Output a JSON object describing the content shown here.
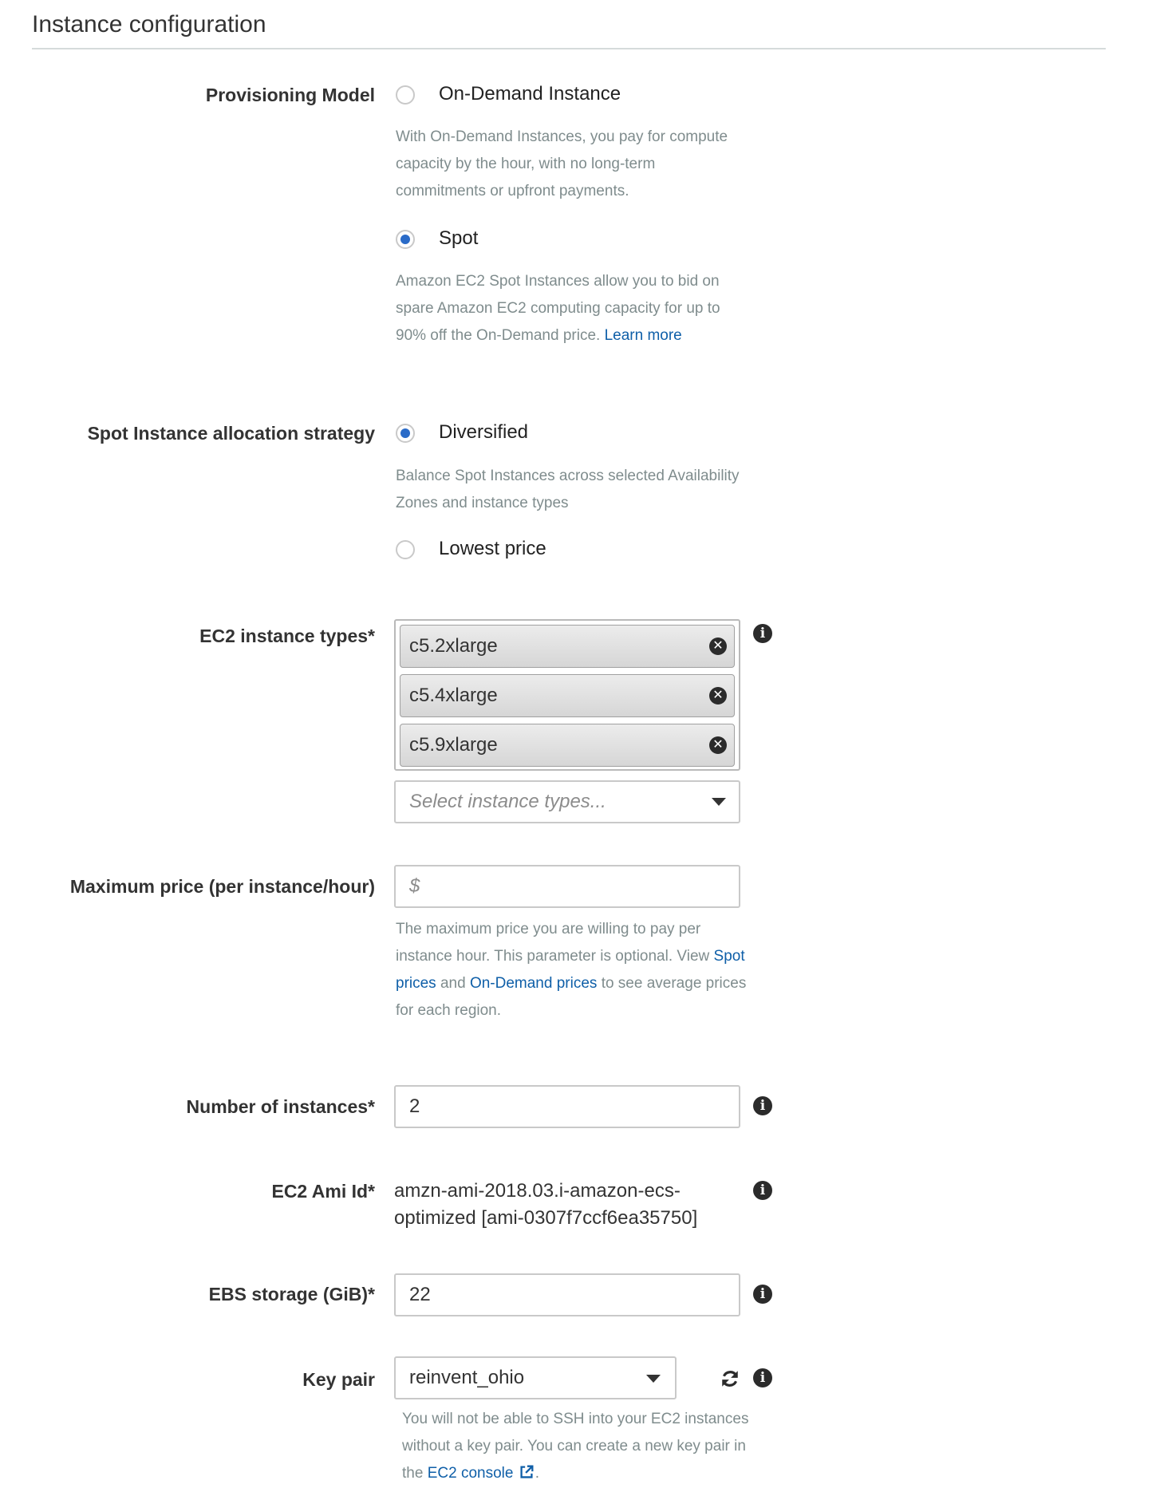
{
  "section": {
    "title": "Instance configuration"
  },
  "provisioning_model": {
    "label": "Provisioning Model",
    "options": [
      {
        "label": "On-Demand Instance",
        "checked": false,
        "help": "With On-Demand Instances, you pay for compute capacity by the hour, with no long-term commitments or upfront payments."
      },
      {
        "label": "Spot",
        "checked": true,
        "help": "Amazon EC2 Spot Instances allow you to bid on spare Amazon EC2 computing capacity for up to 90% off the On-Demand price.",
        "link": "Learn more"
      }
    ]
  },
  "allocation_strategy": {
    "label": "Spot Instance allocation strategy",
    "options": [
      {
        "label": "Diversified",
        "checked": true,
        "help": "Balance Spot Instances across selected Availability Zones and instance types"
      },
      {
        "label": "Lowest price",
        "checked": false
      }
    ]
  },
  "instance_types": {
    "label": "EC2 instance types*",
    "selected": [
      "c5.2xlarge",
      "c5.4xlarge",
      "c5.9xlarge"
    ],
    "placeholder": "Select instance types..."
  },
  "max_price": {
    "label": "Maximum price (per instance/hour)",
    "placeholder": "$",
    "value": "",
    "help_part1": "The maximum price you are willing to pay per instance hour. This parameter is optional. View",
    "link_spot": "Spot prices",
    "and": "and",
    "link_ondemand": "On-Demand prices",
    "help_part2": "to see average prices for each region."
  },
  "num_instances": {
    "label": "Number of instances*",
    "value": "2"
  },
  "ami": {
    "label": "EC2 Ami Id*",
    "value": "amzn-ami-2018.03.i-amazon-ecs-optimized [ami-0307f7ccf6ea35750]"
  },
  "ebs": {
    "label": "EBS storage (GiB)*",
    "value": "22"
  },
  "key_pair": {
    "label": "Key pair",
    "value": "reinvent_ohio",
    "help": "You will not be able to SSH into your EC2 instances without a key pair. You can create a new key pair in the",
    "link": "EC2 console",
    "help_end": "."
  },
  "icons": {
    "info": "info-icon",
    "remove": "remove-tag-icon",
    "dropdown": "chevron-down-icon",
    "refresh": "refresh-icon",
    "external": "external-link-icon"
  },
  "colors": {
    "accent": "#2a6bc8",
    "link": "#0f5fa8",
    "help_text": "#7f8c8d",
    "rule": "#d5dbdb"
  }
}
